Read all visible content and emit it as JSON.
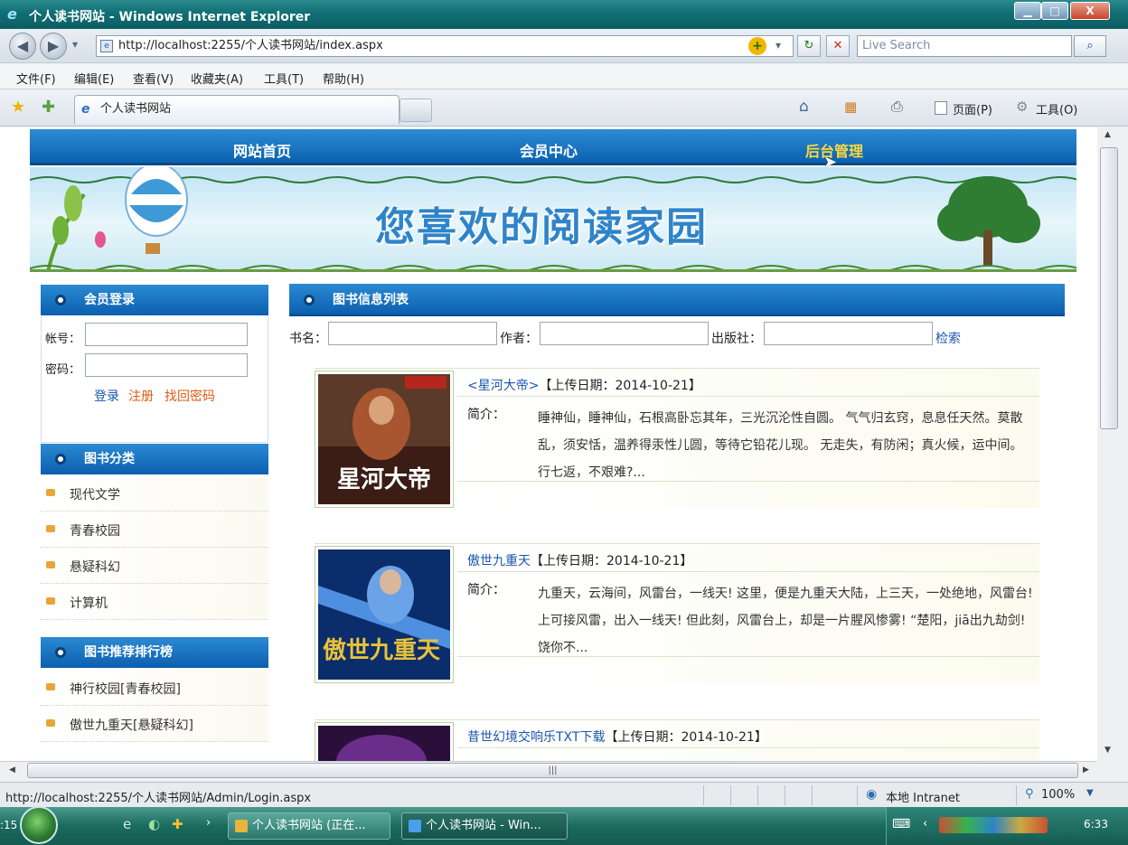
{
  "window": {
    "title": "个人读书网站 - Windows Internet Explorer",
    "minimize_glyph": "▁",
    "maximize_glyph": "□",
    "close_glyph": "X"
  },
  "addressbar": {
    "back_glyph": "◀",
    "forward_glyph": "▶",
    "dropdown_glyph": "▾",
    "url": "http://localhost:2255/个人读书网站/index.aspx",
    "go_glyph": "↻",
    "refresh_glyph": "↻",
    "stop_glyph": "✕",
    "search_placeholder": "Live Search",
    "search_glyph": "⌕"
  },
  "menubar": {
    "items": [
      "文件(F)",
      "编辑(E)",
      "查看(V)",
      "收藏夹(A)",
      "工具(T)",
      "帮助(H)"
    ]
  },
  "tabbar": {
    "tab_title": "个人读书网站",
    "tools": {
      "home": "⌂",
      "feeds": "▦",
      "print": "⎙",
      "page": "页面(P)",
      "tools": "工具(O)"
    }
  },
  "site": {
    "nav": [
      "网站首页",
      "会员中心",
      "后台管理"
    ],
    "banner_slogan": "您喜欢的阅读家园",
    "login": {
      "title": "会员登录",
      "account_label": "帐号：",
      "password_label": "密码：",
      "login_link": "登录",
      "register_link": "注册",
      "forgot_link": "找回密码"
    },
    "categories": {
      "title": "图书分类",
      "items": [
        "现代文学",
        "青春校园",
        "悬疑科幻",
        "计算机"
      ]
    },
    "ranking": {
      "title": "图书推荐排行榜",
      "items": [
        "神行校园[青春校园]",
        "傲世九重天[悬疑科幻]"
      ]
    },
    "booklist": {
      "title": "图书信息列表",
      "filter": {
        "name_label": "书名：",
        "author_label": "作者：",
        "publisher_label": "出版社：",
        "search_link": "检索"
      },
      "intro_label": "简介：",
      "books": [
        {
          "title": "<星河大帝>",
          "date": "【上传日期：2014-10-21】",
          "intro": "睡神仙，睡神仙，石根高卧忘其年，三光沉沦性自圆。 气气归玄窍，息息任天然。莫散乱，须安恬，温养得汞性儿圆，等待它铅花儿现。 无走失，有防闲；真火候，运中间。 行七返，不艰难?..."
        },
        {
          "title": "傲世九重天",
          "date": "【上传日期：2014-10-21】",
          "intro": "九重天，云海间，风雷台，一线天! 这里，便是九重天大陆，上三天，一处绝地，风雷台! 上可接风雷，出入一线天! 但此刻，风雷台上，却是一片腥风惨雾! “楚阳，jiā出九劫剑! 饶你不..."
        },
        {
          "title": "昔世幻境交响乐TXT下载",
          "date": "【上传日期：2014-10-21】",
          "intro": ""
        }
      ]
    }
  },
  "statusbar": {
    "url": "http://localhost:2255/个人读书网站/Admin/Login.aspx",
    "zone": "本地 Intranet",
    "zoom": "100%"
  },
  "taskbar": {
    "clock_left": ":15",
    "buttons": [
      "个人读书网站 (正在...",
      "个人读书网站 - Win..."
    ],
    "time": "6:33"
  },
  "colors": {
    "nav_blue": "#0b62b0",
    "link_blue": "#1a56b0",
    "link_red": "#e05a12",
    "nav_highlight": "#ffd83a"
  }
}
